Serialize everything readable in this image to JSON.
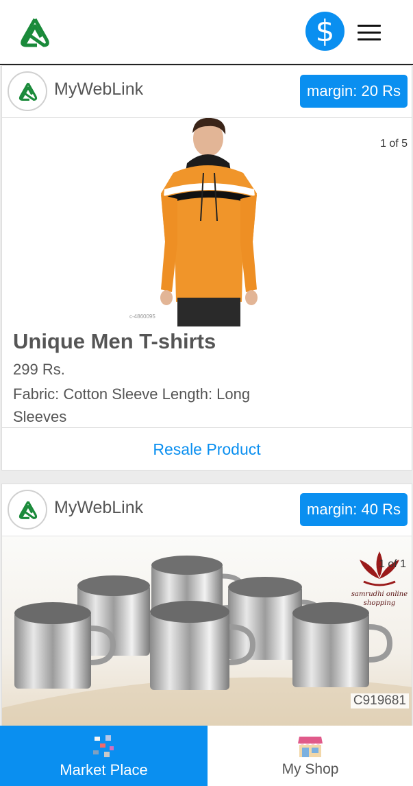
{
  "header": {
    "logo_icon": "triangle-knot-logo",
    "currency_icon": "dollar-icon",
    "currency_symbol": "$",
    "menu_icon": "hamburger-menu-icon",
    "accent_color": "#0a8ff0"
  },
  "feed": {
    "cards": [
      {
        "seller_name": "MyWebLink",
        "margin": "margin: 20 Rs",
        "image_counter": "1 of 5",
        "image_code": "c-4860095",
        "title": "Unique Men T-shirts",
        "price": "299 Rs.",
        "description": "Fabric: Cotton Sleeve Length: Long Sleeves",
        "action_label": "Resale Product"
      },
      {
        "seller_name": "MyWebLink",
        "margin": "margin: 40 Rs",
        "image_counter": "1 of 1",
        "watermark_text": "samrudhi online shopping",
        "image_code": "C919681"
      }
    ]
  },
  "bottom_nav": {
    "items": [
      {
        "label": "Market Place",
        "icon": "market-place-icon",
        "active": true
      },
      {
        "label": "My Shop",
        "icon": "storefront-icon",
        "active": false
      }
    ]
  }
}
